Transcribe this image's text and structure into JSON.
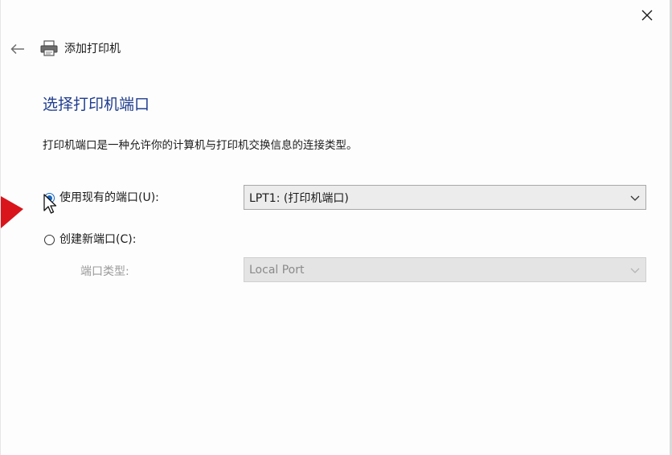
{
  "window": {
    "title": "添加打印机",
    "icons": {
      "close": "close-icon",
      "back": "back-arrow-icon",
      "header": "printer-icon"
    }
  },
  "page": {
    "heading": "选择打印机端口",
    "description": "打印机端口是一种允许你的计算机与打印机交换信息的连接类型。"
  },
  "options": {
    "use_existing": {
      "label": "使用现有的端口(U):",
      "selected": true,
      "select_value": "LPT1: (打印机端口)"
    },
    "create_new": {
      "label": "创建新端口(C):",
      "selected": false,
      "port_type_label": "端口类型:",
      "select_value": "Local Port",
      "disabled": true
    }
  },
  "colors": {
    "heading": "#1f3d8f",
    "radio_selected": "#1565c0",
    "annotation_arrow": "#d9141b"
  }
}
